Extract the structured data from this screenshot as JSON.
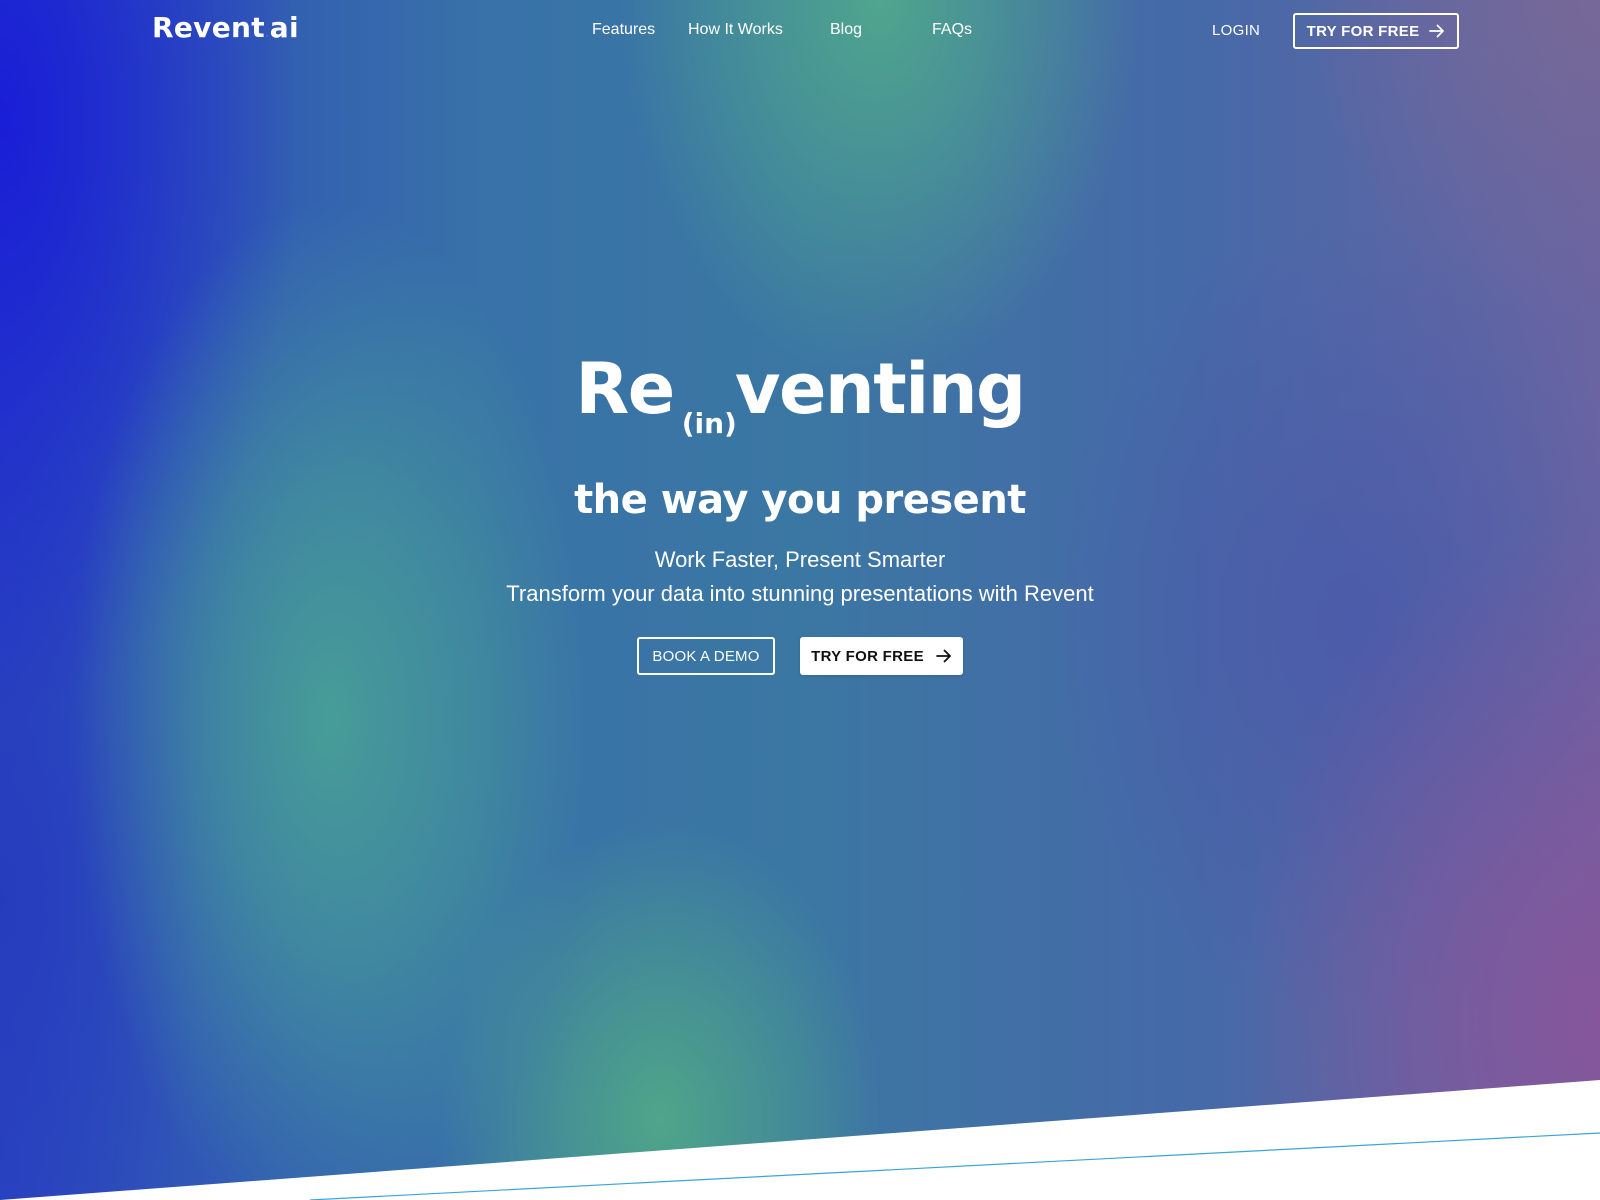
{
  "brand": {
    "name": "Revent",
    "suffix": "ai",
    "dot": "."
  },
  "nav": {
    "links": [
      {
        "label": "Features"
      },
      {
        "label": "How It Works"
      },
      {
        "label": "Blog"
      },
      {
        "label": "FAQs"
      }
    ],
    "login_label": "LOGIN",
    "cta_label": "TRY FOR FREE",
    "cta_icon": "arrow-right-icon"
  },
  "hero": {
    "headline_prefix": "Re",
    "headline_inline": "(in)",
    "headline_suffix": "venting",
    "subheadline": "the way you present",
    "tagline_1": "Work Faster, Present Smarter",
    "tagline_2": "Transform your data into stunning presentations with Revent",
    "demo_button_label": "BOOK A DEMO",
    "try_button_label": "TRY FOR FREE",
    "try_button_icon": "arrow-right-icon"
  },
  "colors": {
    "background_top_left": "#1a1fd6",
    "background_teal": "#48a096",
    "background_green": "#50a88a",
    "background_purple": "#87559b",
    "background_blue": "#3a62a8",
    "accent_line": "#3aa6d6",
    "text": "#ffffff",
    "logo_dot": "#2f6bff"
  }
}
